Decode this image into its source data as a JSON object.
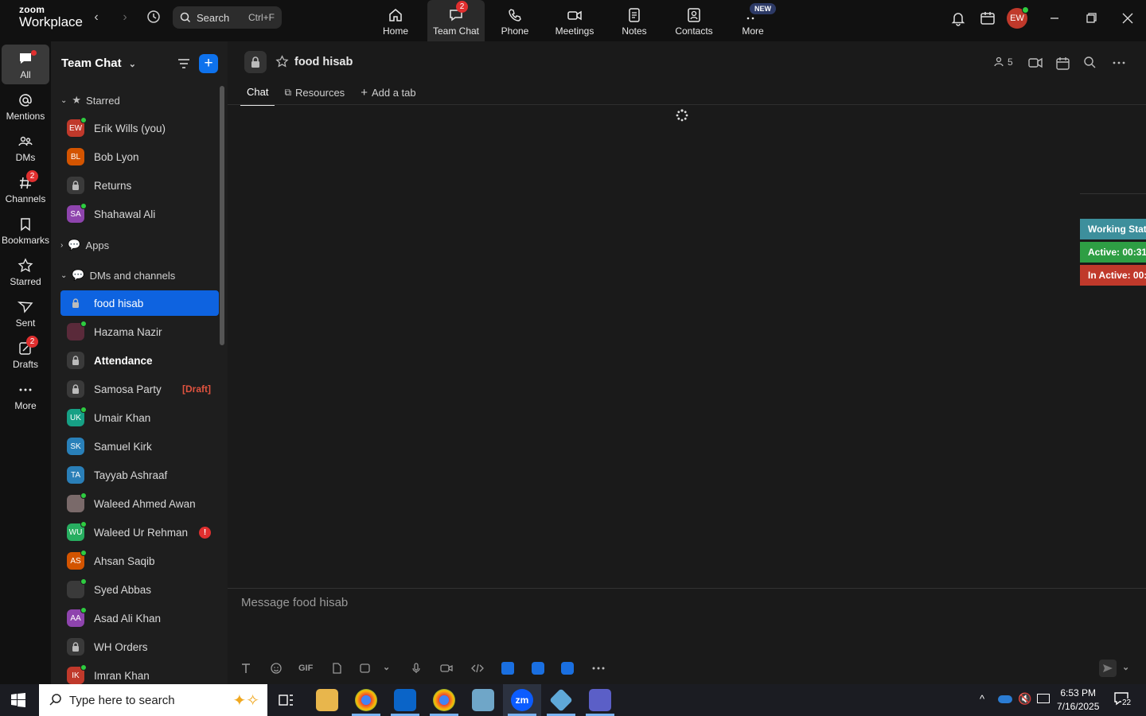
{
  "app": {
    "logo_line1": "zoom",
    "logo_line2": "Workplace",
    "search_label": "Search",
    "search_shortcut": "Ctrl+F"
  },
  "top_tabs": [
    {
      "label": "Home",
      "icon": "home-icon"
    },
    {
      "label": "Team Chat",
      "icon": "chat-icon",
      "badge": "2"
    },
    {
      "label": "Phone",
      "icon": "phone-icon"
    },
    {
      "label": "Meetings",
      "icon": "video-icon"
    },
    {
      "label": "Notes",
      "icon": "notes-icon"
    },
    {
      "label": "Contacts",
      "icon": "contacts-icon"
    },
    {
      "label": "More",
      "icon": "more-icon",
      "badge": "NEW"
    }
  ],
  "user_avatar": "EW",
  "rail": [
    {
      "label": "All"
    },
    {
      "label": "Mentions"
    },
    {
      "label": "DMs"
    },
    {
      "label": "Channels",
      "badge": "2"
    },
    {
      "label": "Bookmarks"
    },
    {
      "label": "Starred"
    },
    {
      "label": "Sent"
    },
    {
      "label": "Drafts",
      "badge": "2"
    },
    {
      "label": "More"
    }
  ],
  "sidebar": {
    "title": "Team Chat",
    "starred_label": "Starred",
    "apps_label": "Apps",
    "dms_label": "DMs and channels",
    "starred": [
      {
        "name": "Erik Wills (you)",
        "initials": "EW",
        "color": "#c0392b",
        "online": true
      },
      {
        "name": "Bob Lyon",
        "initials": "BL",
        "color": "#d35400",
        "online": false
      },
      {
        "name": "Returns",
        "lock": true
      },
      {
        "name": "Shahawal Ali",
        "initials": "SA",
        "color": "#8e44ad",
        "online": true
      }
    ],
    "items": [
      {
        "name": "food hisab",
        "lock": true,
        "selected": true
      },
      {
        "name": "Hazama Nazir",
        "initials": "",
        "color": "#5a2a3a",
        "online": true
      },
      {
        "name": "Attendance",
        "lock": true,
        "bold": true
      },
      {
        "name": "Samosa Party",
        "lock": true,
        "draft": "[Draft]"
      },
      {
        "name": "Umair Khan",
        "initials": "UK",
        "color": "#16a085",
        "online": true
      },
      {
        "name": "Samuel Kirk",
        "initials": "SK",
        "color": "#2980b9",
        "online": false
      },
      {
        "name": "Tayyab Ashraaf",
        "initials": "TA",
        "color": "#2a7fb8",
        "online": false
      },
      {
        "name": "Waleed Ahmed Awan",
        "initials": "",
        "color": "#7a6a6a",
        "online": true
      },
      {
        "name": "Waleed Ur Rehman",
        "initials": "WU",
        "color": "#27ae60",
        "online": true,
        "alert": "!"
      },
      {
        "name": "Ahsan Saqib",
        "initials": "AS",
        "color": "#d35400",
        "online": true
      },
      {
        "name": "Syed Abbas",
        "initials": "",
        "color": "#3a3a3a",
        "online": true
      },
      {
        "name": "Asad Ali Khan",
        "initials": "AA",
        "color": "#8e44ad",
        "online": true
      },
      {
        "name": "WH Orders",
        "lock": true
      },
      {
        "name": "Imran Khan",
        "initials": "IK",
        "color": "#c0392b",
        "online": true
      }
    ]
  },
  "main": {
    "channel_name": "food hisab",
    "member_count": "5",
    "tabs": [
      "Chat",
      "Resources",
      "Add a tab"
    ],
    "composer_placeholder": "Message food hisab",
    "gif_label": "GIF"
  },
  "working_status": {
    "title": "Working Stat",
    "active": "Active: 00:31",
    "inactive": "In Active: 00:",
    "title_color": "#3d8f9c",
    "active_color": "#2e9e44",
    "inactive_color": "#c0392b"
  },
  "taskbar": {
    "search_placeholder": "Type here to search",
    "time": "6:53 PM",
    "date": "7/16/2025",
    "notifications": "22"
  }
}
